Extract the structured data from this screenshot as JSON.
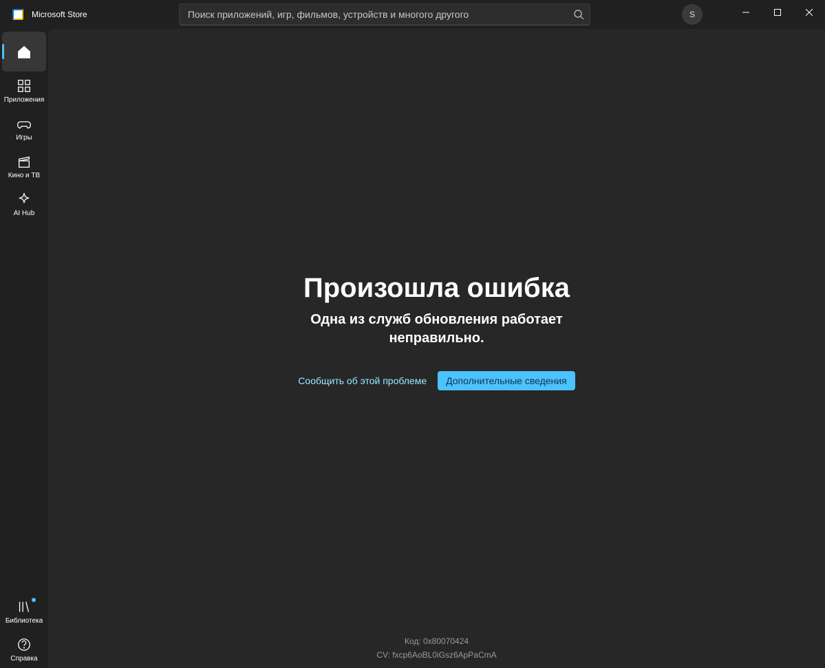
{
  "header": {
    "app_title": "Microsoft Store",
    "search_placeholder": "Поиск приложений, игр, фильмов, устройств и многого другого",
    "avatar_letter": "S"
  },
  "sidebar": {
    "items": [
      {
        "key": "home",
        "label": ""
      },
      {
        "key": "apps",
        "label": "Приложения"
      },
      {
        "key": "games",
        "label": "Игры"
      },
      {
        "key": "movies",
        "label": "Кино и ТВ"
      },
      {
        "key": "aihub",
        "label": "AI Hub"
      }
    ],
    "bottom": [
      {
        "key": "library",
        "label": "Библиотека",
        "has_notification": true
      },
      {
        "key": "help",
        "label": "Справка"
      }
    ]
  },
  "error": {
    "title": "Произошла ошибка",
    "subtitle": "Одна из служб обновления работает неправильно.",
    "report_link": "Сообщить об этой проблеме",
    "more_info_button": "Дополнительные сведения",
    "code_line": "Код: 0x80070424",
    "cv_line": "CV: fxcp6AoBL0iGsz6ApPaCmA"
  }
}
